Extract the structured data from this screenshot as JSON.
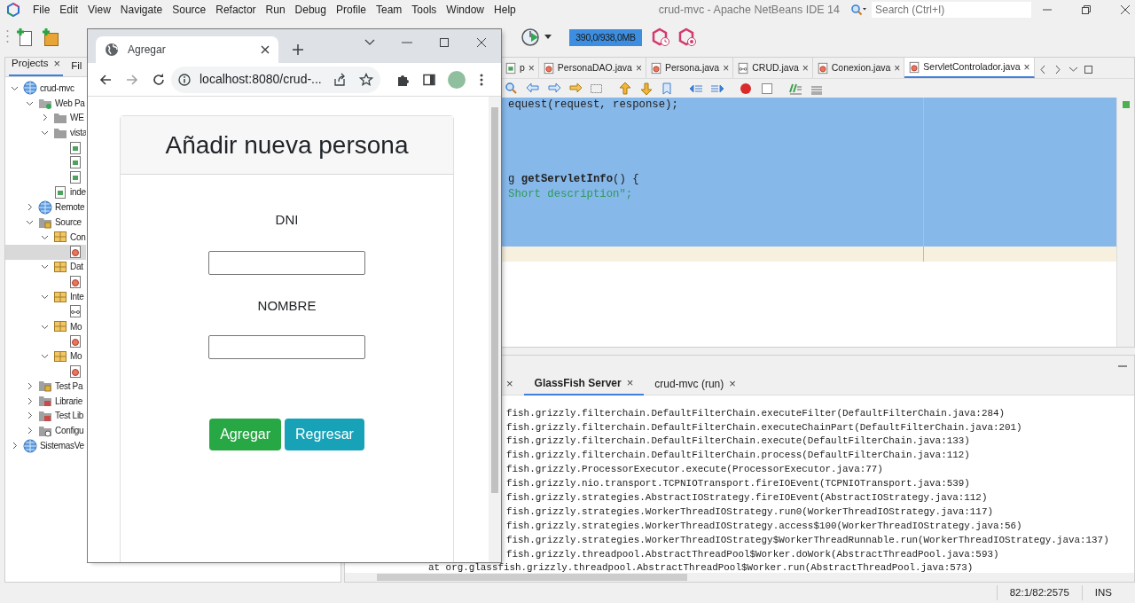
{
  "title": "crud-mvc - Apache NetBeans IDE 14",
  "menu": [
    "File",
    "Edit",
    "View",
    "Navigate",
    "Source",
    "Refactor",
    "Run",
    "Debug",
    "Profile",
    "Team",
    "Tools",
    "Window",
    "Help"
  ],
  "search": {
    "placeholder": "Search (Ctrl+I)"
  },
  "memory": {
    "reading": "390,0/938,0MB"
  },
  "projects_panel": {
    "tabs": [
      {
        "label": "Projects",
        "close": "×",
        "selected": true
      },
      {
        "label": "Fil",
        "selected": false
      }
    ],
    "tree": [
      {
        "label": "crud-mvc",
        "kind": "globe",
        "expanded": true,
        "selected": false,
        "children": [
          {
            "label": "Web Pa",
            "kind": "webfolder",
            "expanded": true,
            "selected": false,
            "children": [
              {
                "label": "WE",
                "kind": "folder",
                "expanded": false,
                "selected": false
              },
              {
                "label": "vista",
                "kind": "folder",
                "expanded": true,
                "selected": false,
                "children": [
                  {
                    "kind": "page",
                    "selected": false
                  },
                  {
                    "kind": "page",
                    "selected": false
                  },
                  {
                    "kind": "page",
                    "selected": false
                  }
                ]
              },
              {
                "label": "inde",
                "kind": "page",
                "selected": false
              }
            ]
          },
          {
            "label": "Remote",
            "kind": "globe",
            "expanded": false,
            "selected": false
          },
          {
            "label": "Source",
            "kind": "source",
            "expanded": true,
            "selected": false,
            "children": [
              {
                "label": "Con",
                "kind": "package",
                "expanded": true,
                "selected": false,
                "children": [
                  {
                    "kind": "class",
                    "selected": true
                  }
                ]
              },
              {
                "label": "Dat",
                "kind": "package",
                "expanded": true,
                "selected": false,
                "children": [
                  {
                    "kind": "class",
                    "selected": false
                  }
                ]
              },
              {
                "label": "Inte",
                "kind": "package",
                "expanded": true,
                "selected": false,
                "children": [
                  {
                    "kind": "interface",
                    "selected": false
                  }
                ]
              },
              {
                "label": "Mo",
                "kind": "package",
                "expanded": true,
                "selected": false,
                "children": [
                  {
                    "kind": "class",
                    "selected": false
                  }
                ]
              },
              {
                "label": "Mo",
                "kind": "package",
                "expanded": true,
                "selected": false,
                "children": [
                  {
                    "kind": "class",
                    "selected": false
                  }
                ]
              }
            ]
          },
          {
            "label": "Test Pa",
            "kind": "source",
            "expanded": false,
            "selected": false
          },
          {
            "label": "Librarie",
            "kind": "library",
            "expanded": false,
            "selected": false
          },
          {
            "label": "Test Lib",
            "kind": "library",
            "expanded": false,
            "selected": false
          },
          {
            "label": "Configu",
            "kind": "config",
            "expanded": false,
            "selected": false
          }
        ]
      },
      {
        "label": "SistemasVe",
        "kind": "globe",
        "expanded": false,
        "selected": false
      }
    ]
  },
  "editor": {
    "tabs": [
      {
        "label": "p",
        "kind": "page",
        "close": "×",
        "selected": false
      },
      {
        "label": "PersonaDAO.java",
        "kind": "class",
        "close": "×",
        "selected": false
      },
      {
        "label": "Persona.java",
        "kind": "class",
        "close": "×",
        "selected": false
      },
      {
        "label": "CRUD.java",
        "kind": "interface",
        "close": "×",
        "selected": false
      },
      {
        "label": "Conexion.java",
        "kind": "class",
        "close": "×",
        "selected": false
      },
      {
        "label": "ServletControlador.java",
        "kind": "class",
        "close": "×",
        "selected": true
      }
    ],
    "lines": [
      {
        "text": "equest(request, response);",
        "kind": "plain",
        "selected": true,
        "current": false
      },
      {
        "selected": true,
        "current": false
      },
      {
        "selected": true,
        "current": false
      },
      {
        "selected": true,
        "current": false
      },
      {
        "selected": true,
        "current": false
      },
      {
        "text": "g **getServletInfo**() {",
        "kind": "plain",
        "selected": true,
        "current": false
      },
      {
        "text": "Short description\";",
        "kind": "string",
        "selected": true,
        "current": false
      },
      {
        "selected": true,
        "current": false
      },
      {
        "selected": true,
        "current": false
      },
      {
        "selected": true,
        "current": false
      },
      {
        "selected": false,
        "current": true
      }
    ]
  },
  "output": {
    "tabs": [
      {
        "close": "×",
        "selected": false
      },
      {
        "label": "GlassFish Server",
        "close": "×",
        "selected": true
      },
      {
        "label": "crud-mvc (run)",
        "close": "×",
        "selected": false
      }
    ],
    "lines": [
      {
        "text": "fish.grizzly.filterchain.DefaultFilterChain.executeFilter(DefaultFilterChain.java:284)",
        "kind": "cut"
      },
      {
        "text": "fish.grizzly.filterchain.DefaultFilterChain.executeChainPart(DefaultFilterChain.java:201)",
        "kind": "cut"
      },
      {
        "text": "fish.grizzly.filterchain.DefaultFilterChain.execute(DefaultFilterChain.java:133)",
        "kind": "cut"
      },
      {
        "text": "fish.grizzly.filterchain.DefaultFilterChain.process(DefaultFilterChain.java:112)",
        "kind": "cut"
      },
      {
        "text": "fish.grizzly.ProcessorExecutor.execute(ProcessorExecutor.java:77)",
        "kind": "cut"
      },
      {
        "text": "fish.grizzly.nio.transport.TCPNIOTransport.fireIOEvent(TCPNIOTransport.java:539)",
        "kind": "cut"
      },
      {
        "text": "fish.grizzly.strategies.AbstractIOStrategy.fireIOEvent(AbstractIOStrategy.java:112)",
        "kind": "cut"
      },
      {
        "text": "fish.grizzly.strategies.WorkerThreadIOStrategy.run0(WorkerThreadIOStrategy.java:117)",
        "kind": "cut"
      },
      {
        "text": "fish.grizzly.strategies.WorkerThreadIOStrategy.access$100(WorkerThreadIOStrategy.java:56)",
        "kind": "cut"
      },
      {
        "text": "fish.grizzly.strategies.WorkerThreadIOStrategy$WorkerThreadRunnable.run(WorkerThreadIOStrategy.java:137)",
        "kind": "cut"
      },
      {
        "text": "fish.grizzly.threadpool.AbstractThreadPool$Worker.doWork(AbstractThreadPool.java:593)",
        "kind": "cut"
      },
      {
        "text": "at org.glassfish.grizzly.threadpool.AbstractThreadPool$Worker.run(AbstractThreadPool.java:573)",
        "kind": "full"
      }
    ]
  },
  "status_bar": {
    "position": "82:1/82:2575",
    "mode": "INS"
  },
  "browser": {
    "tab_title": "Agregar",
    "url": "localhost:8080/crud-...",
    "form": {
      "heading": "Añadir nueva persona",
      "fields": [
        {
          "label": "DNI"
        },
        {
          "label": "NOMBRE"
        }
      ],
      "buttons": [
        {
          "label": "Agregar",
          "kind": "success"
        },
        {
          "label": "Regresar",
          "kind": "info"
        }
      ]
    }
  }
}
